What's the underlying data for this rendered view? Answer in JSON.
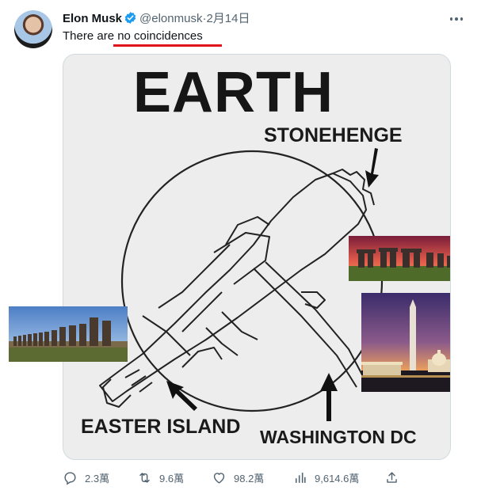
{
  "tweet": {
    "author_name": "Elon Musk",
    "handle": "@elonmusk",
    "separator": "·",
    "date": "2月14日",
    "text_prefix": "There are ",
    "text_highlight": "no coincidences",
    "verified_color": "#1d9bf0",
    "highlight_color": "#e0141a"
  },
  "image": {
    "heading": "EARTH",
    "label_stonehenge": "STONEHENGE",
    "label_easter": "EASTER ISLAND",
    "label_washington": "WASHINGTON DC"
  },
  "actions": {
    "replies": "2.3萬",
    "reposts": "9.6萬",
    "likes": "98.2萬",
    "views": "9,614.6萬"
  },
  "icons": [
    "verified-badge-icon",
    "more-icon",
    "reply-icon",
    "repost-icon",
    "like-icon",
    "views-icon",
    "share-icon"
  ]
}
